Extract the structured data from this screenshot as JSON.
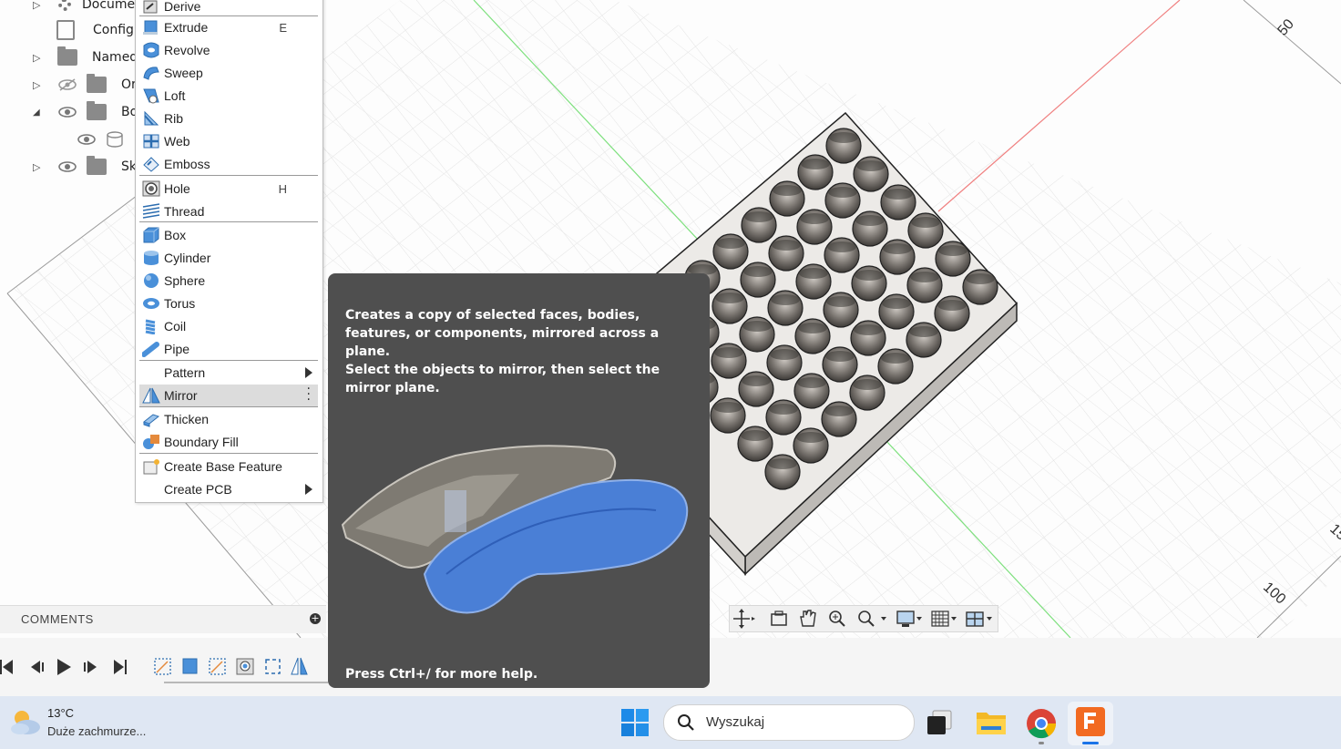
{
  "browser": {
    "items": [
      {
        "label": "Docume",
        "expanded": false
      },
      {
        "label": "Configu",
        "expanded": false
      },
      {
        "label": "Named",
        "expanded": false
      },
      {
        "label": "Or",
        "expanded": false
      },
      {
        "label": "Bo",
        "expanded": true
      },
      {
        "label": "",
        "expanded": false
      },
      {
        "label": "Sk",
        "expanded": false
      }
    ]
  },
  "menu": {
    "derive": "Derive",
    "extrude": "Extrude",
    "extrude_shortcut": "E",
    "revolve": "Revolve",
    "sweep": "Sweep",
    "loft": "Loft",
    "rib": "Rib",
    "web": "Web",
    "emboss": "Emboss",
    "hole": "Hole",
    "hole_shortcut": "H",
    "thread": "Thread",
    "box": "Box",
    "cylinder": "Cylinder",
    "sphere": "Sphere",
    "torus": "Torus",
    "coil": "Coil",
    "pipe": "Pipe",
    "pattern": "Pattern",
    "mirror": "Mirror",
    "thicken": "Thicken",
    "boundary_fill": "Boundary Fill",
    "create_base_feature": "Create Base Feature",
    "create_pcb": "Create PCB"
  },
  "tooltip": {
    "line1": "Creates a copy of selected faces, bodies, features, or components, mirrored across a plane.",
    "line2": "Select the objects to mirror, then select the mirror plane.",
    "footer": "Press Ctrl+/ for more help."
  },
  "comments": {
    "title": "COMMENTS"
  },
  "viewport": {
    "ruler_50": "50",
    "ruler_100": "100",
    "ruler_partial": "15"
  },
  "taskbar": {
    "temperature": "13°C",
    "weather": "Duże zachmurze...",
    "search_placeholder": "Wyszukaj"
  },
  "colors": {
    "accent_blue": "#4a90d9",
    "tooltip_bg": "#4f4f4f",
    "part_color": "#e6e4e1"
  }
}
